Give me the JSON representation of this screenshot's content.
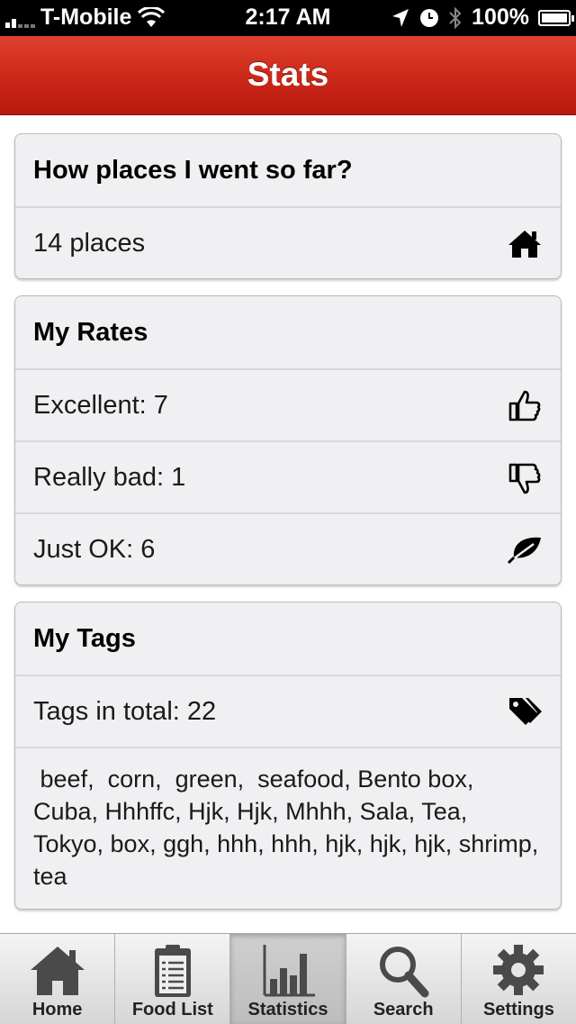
{
  "status_bar": {
    "carrier": "T-Mobile",
    "time": "2:17 AM",
    "battery": "100%",
    "icons": [
      "signal-icon",
      "wifi-icon",
      "location-icon",
      "clock-icon",
      "bluetooth-icon",
      "battery-icon"
    ]
  },
  "nav": {
    "title": "Stats",
    "color": "#cc2a1a"
  },
  "places_card": {
    "header": "How places I went so far?",
    "value": "14 places",
    "icon": "home-icon"
  },
  "rates_card": {
    "header": "My Rates",
    "rows": [
      {
        "label": "Excellent: 7",
        "icon": "thumbs-up-icon"
      },
      {
        "label": "Really bad: 1",
        "icon": "thumbs-down-icon"
      },
      {
        "label": "Just OK: 6",
        "icon": "leaf-icon"
      }
    ]
  },
  "tags_card": {
    "header": "My Tags",
    "total": "Tags in total: 22",
    "icon": "tags-icon",
    "list": " beef,  corn,  green,  seafood, Bento box, Cuba, Hhhffc, Hjk, Hjk, Mhhh, Sala, Tea, Tokyo, box, ggh, hhh, hhh, hjk, hjk, hjk, shrimp, tea"
  },
  "tab_bar": {
    "active": "Statistics",
    "tabs": [
      {
        "label": "Home",
        "icon": "home-icon"
      },
      {
        "label": "Food List",
        "icon": "clipboard-icon"
      },
      {
        "label": "Statistics",
        "icon": "bar-chart-icon"
      },
      {
        "label": "Search",
        "icon": "search-icon"
      },
      {
        "label": "Settings",
        "icon": "gear-icon"
      }
    ]
  }
}
